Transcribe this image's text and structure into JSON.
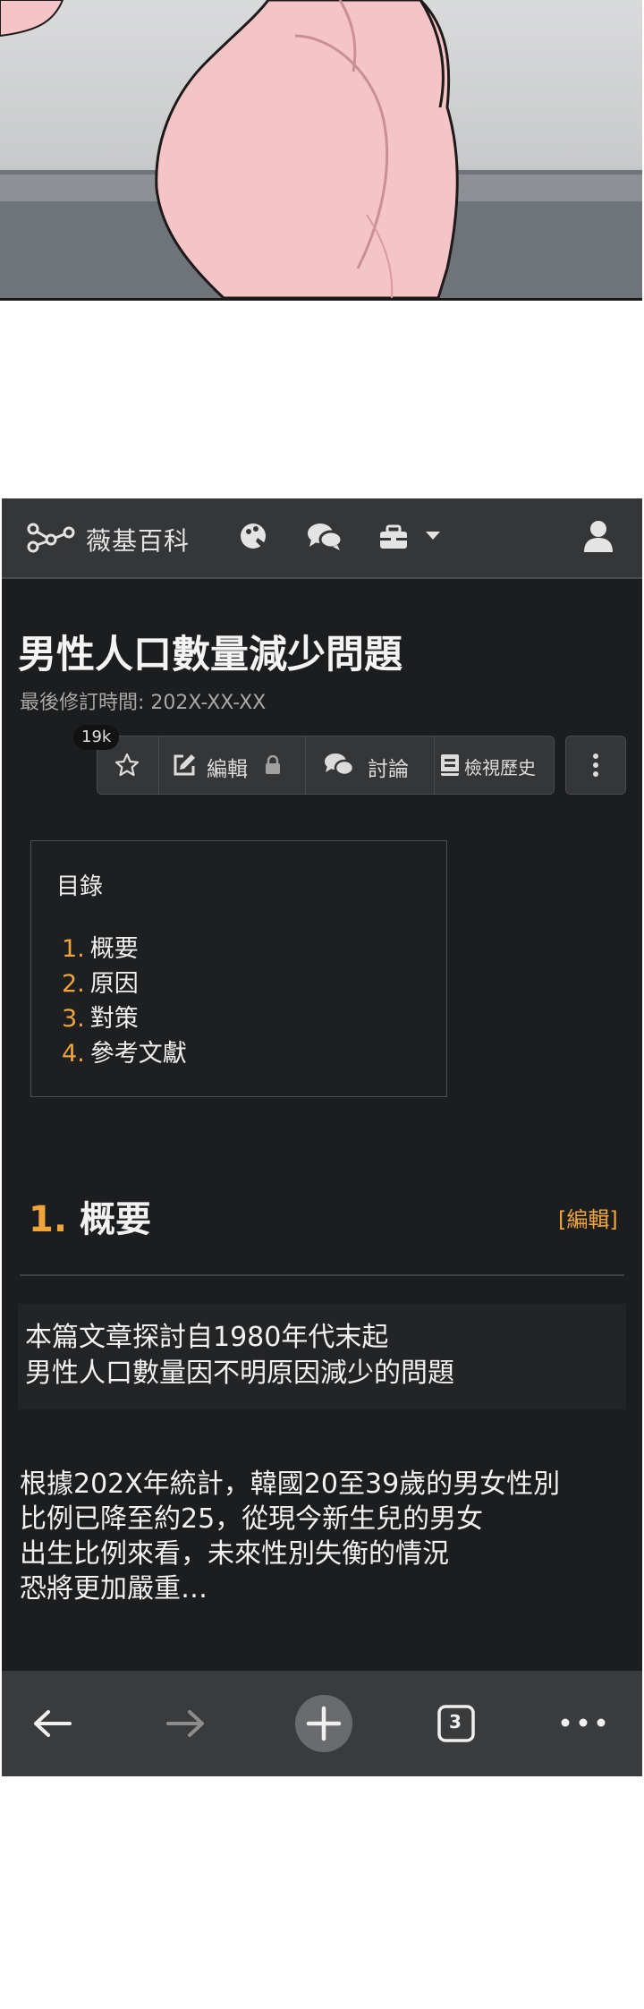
{
  "colors": {
    "page_bg": "#ffffff",
    "screen_bg": "#1c1d1f",
    "header_bg": "#353638",
    "accent": "#f0a53a",
    "text": "#f2f2f2",
    "muted": "#a8a8a8",
    "bottom_bar_bg": "#3a3b3d"
  },
  "header": {
    "brand_name": "薇基百科",
    "icons": [
      "logo-icon",
      "palette-icon",
      "chat-icon",
      "toolbox-icon",
      "caret-down-icon",
      "user-icon"
    ]
  },
  "article": {
    "title": "男性人口數量減少問題",
    "last_modified": "最後修訂時間: 202X-XX-XX",
    "view_count": "19k",
    "actions": {
      "edit": "編輯",
      "discuss": "討論",
      "history": "檢視歷史"
    }
  },
  "toc": {
    "title": "目錄",
    "items": [
      {
        "num": "1.",
        "label": "概要"
      },
      {
        "num": "2.",
        "label": "原因"
      },
      {
        "num": "3.",
        "label": "對策"
      },
      {
        "num": "4.",
        "label": "參考文獻"
      }
    ]
  },
  "section": {
    "num": "1.",
    "title": "概要",
    "edit_link": "[編輯]",
    "summary": [
      "本篇文章探討自1980年代末起",
      "男性人口數量因不明原因減少的問題"
    ],
    "paragraph": [
      "根據202X年統計，韓國20至39歲的男女性別",
      "比例已降至約25，從現今新生兒的男女",
      "出生比例來看，未來性別失衡的情況",
      "恐將更加嚴重…"
    ]
  },
  "bottom_nav": {
    "tab_count": "3",
    "icons": [
      "back-arrow-icon",
      "forward-arrow-icon",
      "new-tab-icon",
      "tabs-icon",
      "more-icon"
    ]
  }
}
